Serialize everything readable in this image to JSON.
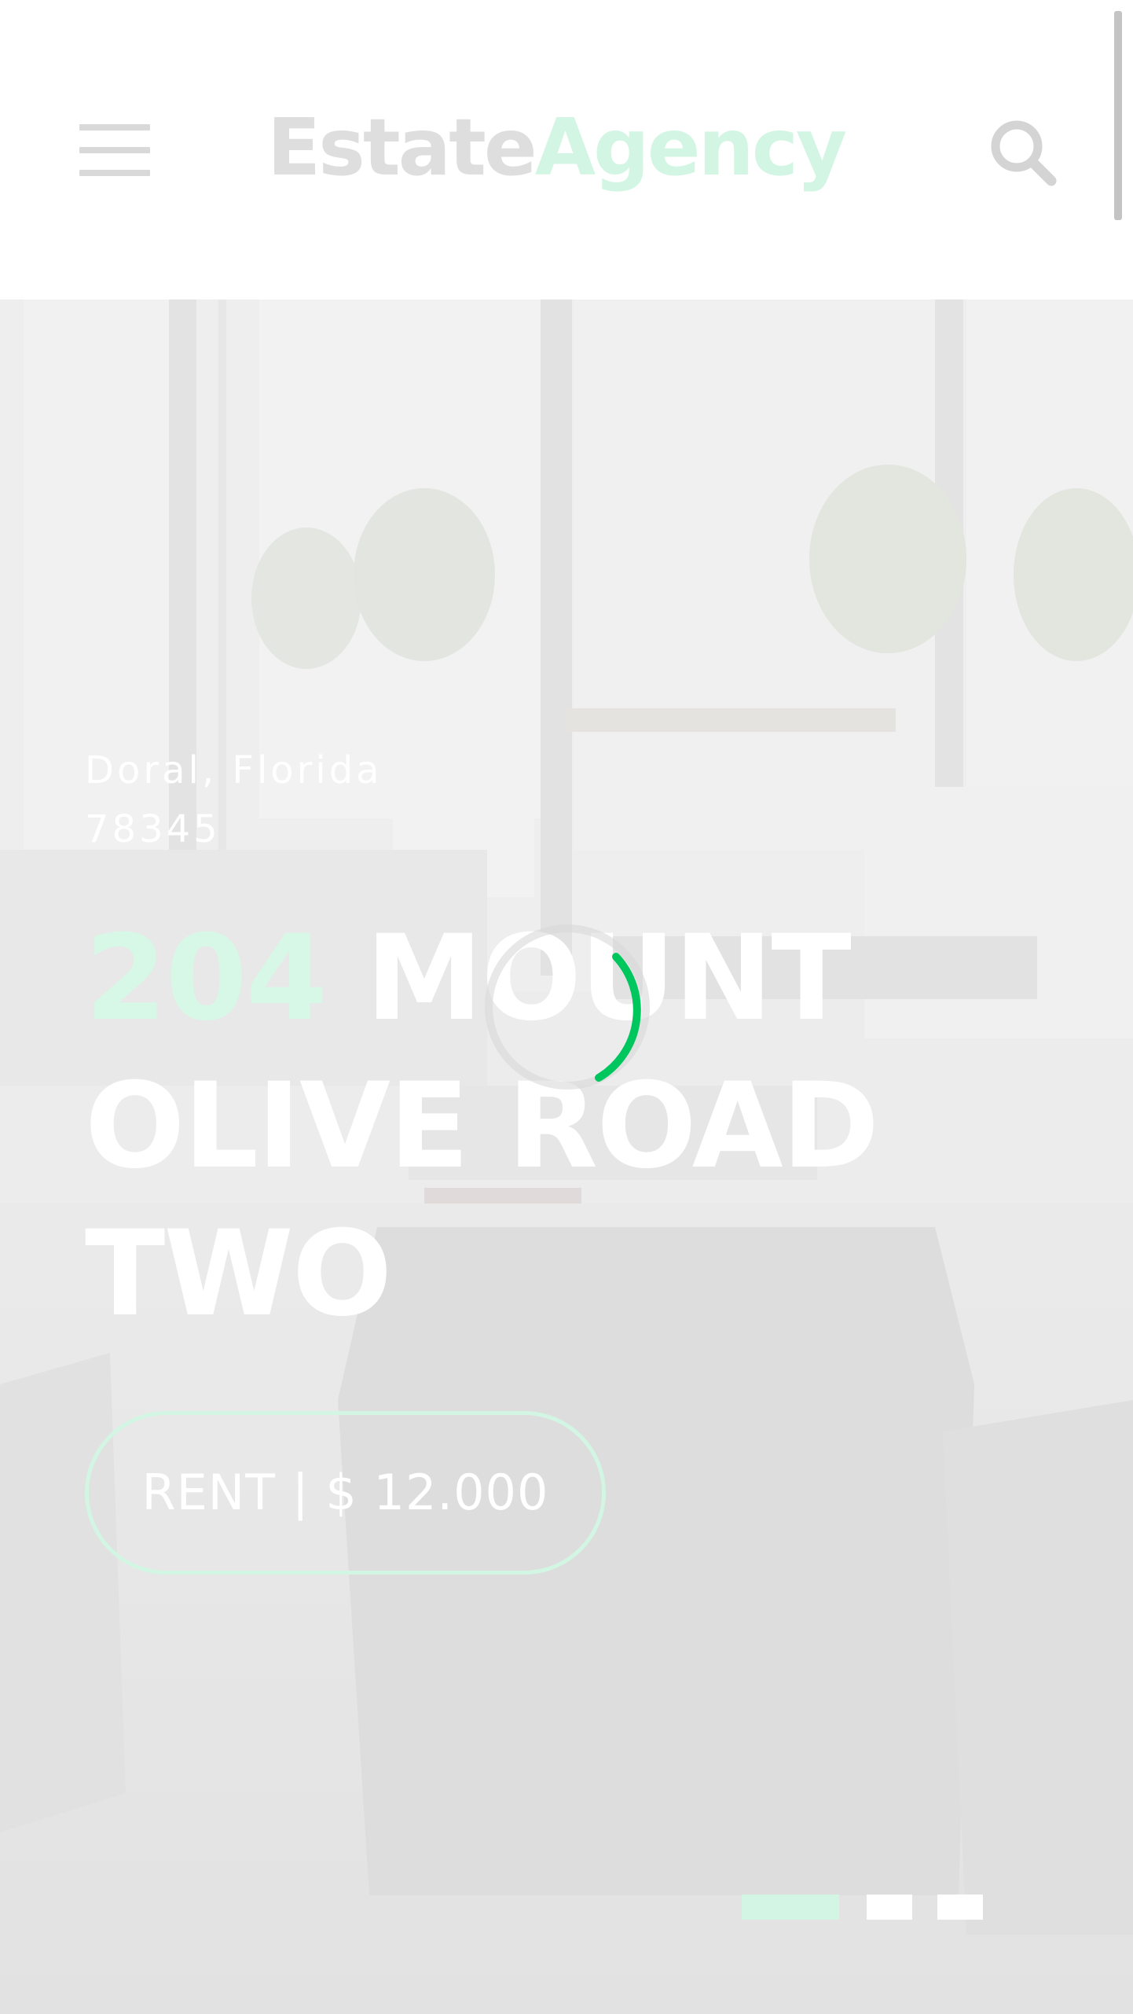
{
  "header": {
    "logo_part1": "Estate",
    "logo_part2": "Agency",
    "menu_icon": "hamburger-menu-icon",
    "search_icon": "search-icon"
  },
  "hero": {
    "location_line1": "Doral, Florida",
    "location_line2": "78345",
    "title_number": "204",
    "title_line1_rest": " MOUNT",
    "title_line2": "OLIVE ROAD",
    "title_line3": "TWO",
    "rent_button": "RENT | $ 12.000",
    "loading_icon": "loading-spinner-icon",
    "slide_indicators": [
      {
        "active": true
      },
      {
        "active": false
      },
      {
        "active": false
      }
    ]
  },
  "colors": {
    "accent_green": "#00c65e",
    "accent_faded": "#d2f6e3",
    "logo_gray": "#dedede"
  }
}
